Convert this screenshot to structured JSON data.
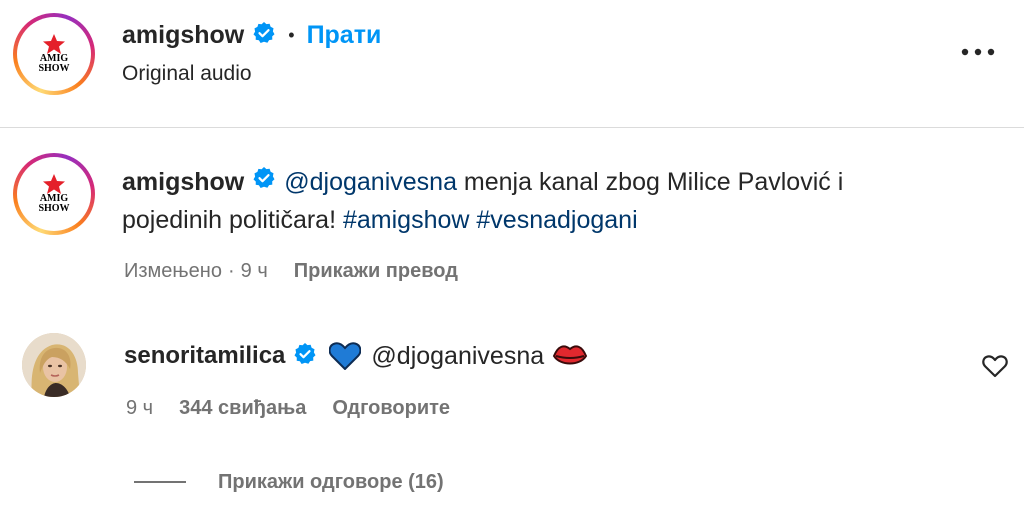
{
  "header": {
    "username": "amigshow",
    "dot": "•",
    "follow_label": "Прати",
    "audio": "Original audio",
    "logo_text_top": "AMIG",
    "logo_text_bottom": "SHOW"
  },
  "caption": {
    "username": "amigshow",
    "mention": "@djoganivesna",
    "text_part1": " menja kanal zbog Milice Pavlović i",
    "text_part2": "pojedinih političara! ",
    "hashtag1": "#amigshow",
    "hashtag2": "#vesnadjogani",
    "edited": "Измењено",
    "dot": "·",
    "time": "9 ч",
    "translate": "Прикажи превод"
  },
  "comment": {
    "username": "senoritamilica",
    "heart_emoji": "💙",
    "mention": "@djoganivesna",
    "kiss_emoji": "💋",
    "time": "9 ч",
    "likes": "344 свиђања",
    "reply": "Одговорите",
    "view_replies": "Прикажи одговоре (16)"
  },
  "colors": {
    "accent": "#0095f6",
    "link": "#00376b",
    "muted": "#737373",
    "verified": "#0095f6"
  }
}
